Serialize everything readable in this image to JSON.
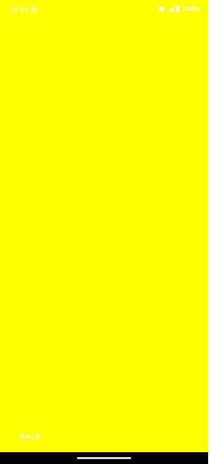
{
  "status_bar": {
    "time": "21:51",
    "battery_text": "100%",
    "left_icon": "sim-card-icon",
    "right_icons": [
      "alarm-dot-icon",
      "wifi-icon",
      "cell-signal-icon",
      "battery-icon"
    ]
  },
  "screen": {
    "background_color": "#ffff00"
  },
  "bottom": {
    "back_label": "BACK"
  },
  "navigation": {
    "home_indicator": "home-indicator"
  }
}
